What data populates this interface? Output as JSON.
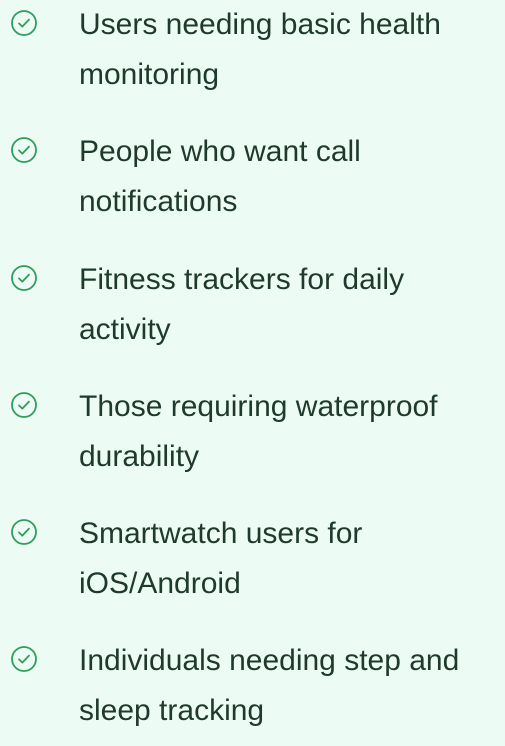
{
  "items": [
    {
      "label": "Users needing basic health monitoring"
    },
    {
      "label": "People who want call notifications"
    },
    {
      "label": "Fitness trackers for daily activity"
    },
    {
      "label": "Those requiring waterproof durability"
    },
    {
      "label": "Smartwatch users for iOS/Android"
    },
    {
      "label": "Individuals needing step and sleep tracking"
    }
  ],
  "icon": "check-circle-icon",
  "colors": {
    "background": "#ecfbf3",
    "icon": "#2f9e5c",
    "text": "#1f3a2d"
  }
}
